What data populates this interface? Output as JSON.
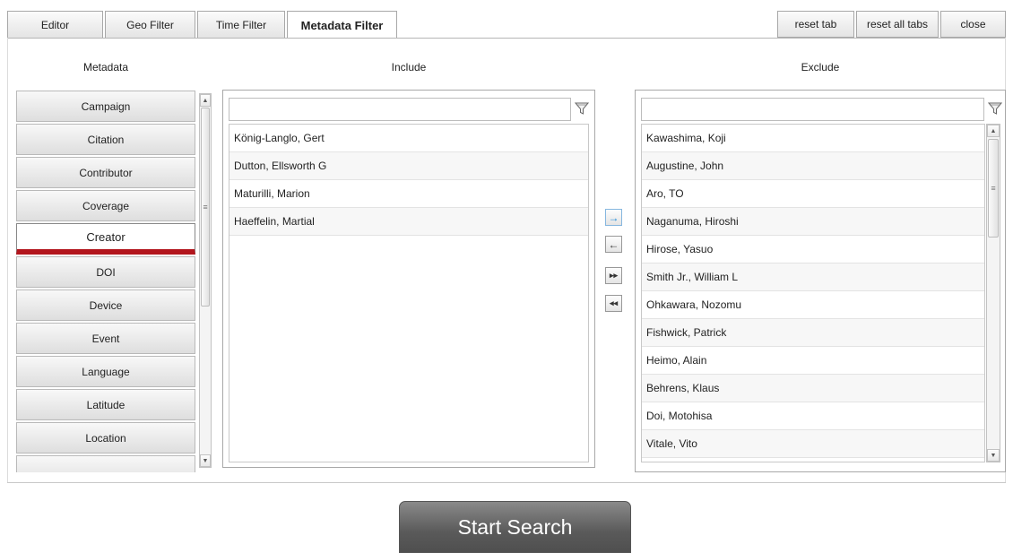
{
  "tabs": [
    {
      "label": "Editor",
      "active": false
    },
    {
      "label": "Geo Filter",
      "active": false
    },
    {
      "label": "Time Filter",
      "active": false
    },
    {
      "label": "Metadata Filter",
      "active": true
    }
  ],
  "toolbar": {
    "reset_tab": "reset tab",
    "reset_all_tabs": "reset all tabs",
    "close": "close"
  },
  "headers": {
    "metadata": "Metadata",
    "include": "Include",
    "exclude": "Exclude"
  },
  "metadata_items": [
    "Campaign",
    "Citation",
    "Contributor",
    "Coverage",
    "Creator",
    "DOI",
    "Device",
    "Event",
    "Language",
    "Latitude",
    "Location"
  ],
  "selected_metadata": "Creator",
  "include": {
    "filter_value": "",
    "items": [
      "König-Langlo, Gert",
      "Dutton, Ellsworth G",
      "Maturilli, Marion",
      "Haeffelin, Martial"
    ]
  },
  "exclude": {
    "filter_value": "",
    "items": [
      "Kawashima, Koji",
      "Augustine, John",
      "Aro, TO",
      "Naganuma, Hiroshi",
      "Hirose, Yasuo",
      "Smith Jr., William L",
      "Ohkawara, Nozomu",
      "Fishwick, Patrick",
      "Heimo, Alain",
      "Behrens, Klaus",
      "Doi, Motohisa",
      "Vitale, Vito"
    ]
  },
  "transfer_buttons": {
    "include_one": "→",
    "exclude_one": "←",
    "include_all": "▸▸",
    "exclude_all": "◂◂"
  },
  "icons": {
    "filter": "funnel-icon",
    "scroll_up": "triangle-up",
    "scroll_down": "triangle-down"
  },
  "colors": {
    "selected_accent": "#b3151d",
    "arrow_blue": "#1a8ad8",
    "search_button": "#5a5a5a"
  },
  "search_button": "Start Search"
}
